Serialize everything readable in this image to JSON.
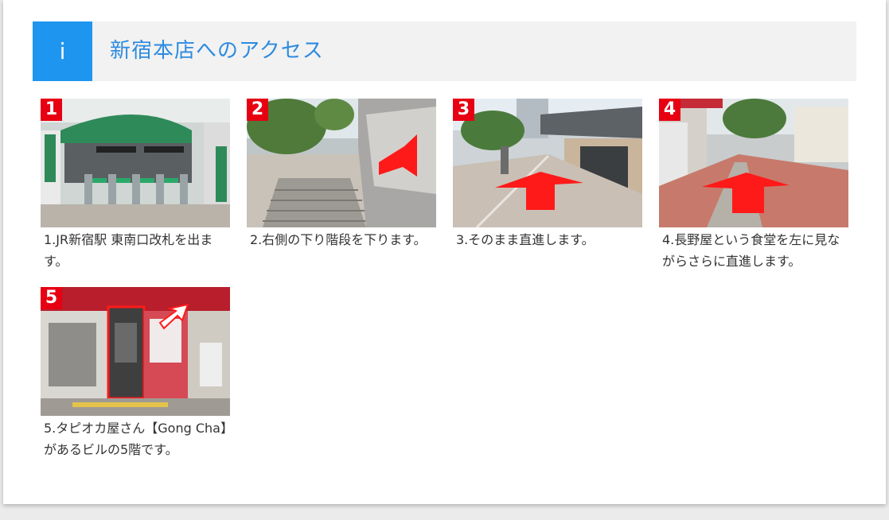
{
  "header": {
    "info_icon_glyph": "i",
    "title": "新宿本店へのアクセス"
  },
  "steps": [
    {
      "number": "1",
      "caption": "1.JR新宿駅 東南口改札を出ます。",
      "photo": "JR新宿駅 東南口改札"
    },
    {
      "number": "2",
      "caption": "2.右側の下り階段を下ります。",
      "photo": "下り階段"
    },
    {
      "number": "3",
      "caption": "3.そのまま直進します。",
      "photo": "直進する歩道"
    },
    {
      "number": "4",
      "caption": "4.長野屋という食堂を左に見ながらさらに直進します。",
      "photo": "長野屋前の道"
    },
    {
      "number": "5",
      "caption": "5.タピオカ屋さん【Gong Cha】があるビルの5階です。",
      "photo": "ビル入口"
    }
  ],
  "colors": {
    "accent": "#1e96f0",
    "title": "#2d8be0",
    "badge": "#e60012",
    "arrow": "#ff0000"
  }
}
